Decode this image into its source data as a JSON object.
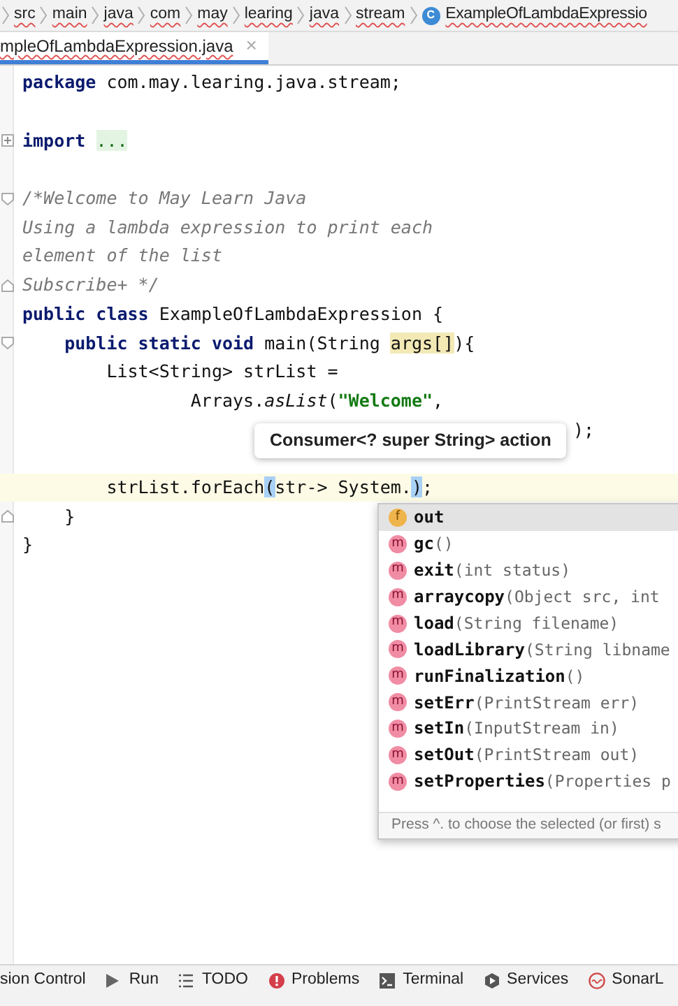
{
  "breadcrumb": {
    "items": [
      "src",
      "main",
      "java",
      "com",
      "may",
      "learing",
      "java",
      "stream"
    ],
    "file": {
      "badge": "C",
      "label": "ExampleOfLambdaExpressio"
    }
  },
  "tabs": [
    {
      "label": "mpleOfLambdaExpression.java",
      "close": "×",
      "selected": true
    }
  ],
  "editor": {
    "lines": [
      {
        "kind": "code",
        "current": false,
        "tokens": [
          {
            "kind": "kw",
            "text": "package"
          },
          {
            "kind": "plain",
            "text": " com.may.learing.java.stream;"
          }
        ]
      },
      {
        "kind": "blank"
      },
      {
        "kind": "code",
        "current": false,
        "fold_marker": {
          "kind": "expand"
        },
        "tokens": [
          {
            "kind": "kw",
            "text": "import "
          },
          {
            "kind": "folded",
            "text": "..."
          }
        ]
      },
      {
        "kind": "blank"
      },
      {
        "kind": "code",
        "current": false,
        "fold_marker": {
          "kind": "start"
        },
        "tokens": [
          {
            "kind": "comment",
            "text": "/*Welcome to May Learn Java"
          }
        ]
      },
      {
        "kind": "code",
        "current": false,
        "tokens": [
          {
            "kind": "comment",
            "text": "Using a lambda expression to print each"
          }
        ]
      },
      {
        "kind": "code",
        "current": false,
        "tokens": [
          {
            "kind": "comment",
            "text": "element of the list"
          }
        ]
      },
      {
        "kind": "code",
        "current": false,
        "fold_marker": {
          "kind": "end"
        },
        "tokens": [
          {
            "kind": "comment",
            "text": "Subscribe+ */"
          }
        ]
      },
      {
        "kind": "code",
        "current": false,
        "tokens": [
          {
            "kind": "kw",
            "text": "public class"
          },
          {
            "kind": "plain",
            "text": " ExampleOfLambdaExpression {"
          }
        ]
      },
      {
        "kind": "code",
        "current": false,
        "fold_marker": {
          "kind": "start"
        },
        "tokens": [
          {
            "kind": "kw",
            "text": "    public static void"
          },
          {
            "kind": "plain",
            "text": " main(String "
          },
          {
            "kind": "usage",
            "text": "args[]"
          },
          {
            "kind": "plain",
            "text": "){"
          }
        ]
      },
      {
        "kind": "code",
        "current": false,
        "tokens": [
          {
            "kind": "plain",
            "text": "        List<String> strList ="
          }
        ]
      },
      {
        "kind": "code",
        "current": false,
        "tokens": [
          {
            "kind": "plain",
            "text": "                Arrays."
          },
          {
            "kind": "static",
            "text": "asList"
          },
          {
            "kind": "plain",
            "text": "("
          },
          {
            "kind": "string",
            "text": "\"Welcome\""
          },
          {
            "kind": "plain",
            "text": ","
          }
        ]
      },
      {
        "kind": "tail",
        "current": false,
        "tokens": [
          {
            "kind": "plain",
            "text": ");"
          }
        ]
      },
      {
        "kind": "blank"
      },
      {
        "kind": "code",
        "current": true,
        "tokens": [
          {
            "kind": "plain",
            "text": "        strList.forEach"
          },
          {
            "kind": "match",
            "text": "("
          },
          {
            "kind": "plain",
            "text": "str-> System."
          },
          {
            "kind": "match",
            "text": ")"
          },
          {
            "kind": "plain",
            "text": ";"
          }
        ]
      },
      {
        "kind": "code",
        "current": false,
        "fold_marker": {
          "kind": "end"
        },
        "tokens": [
          {
            "kind": "plain",
            "text": "    }"
          }
        ]
      },
      {
        "kind": "code",
        "current": false,
        "tokens": [
          {
            "kind": "plain",
            "text": "}"
          }
        ]
      }
    ]
  },
  "tooltip": {
    "text": "Consumer<? super String> action"
  },
  "completion": {
    "items": [
      {
        "kind": "field",
        "badge": "f",
        "name": "out",
        "selected": true
      },
      {
        "kind": "method",
        "badge": "m",
        "name": "gc",
        "params": "()",
        "selected": false
      },
      {
        "kind": "method",
        "badge": "m",
        "name": "exit",
        "params": "(int status)",
        "selected": false
      },
      {
        "kind": "method",
        "badge": "m",
        "name": "arraycopy",
        "params": "(Object src, int",
        "selected": false
      },
      {
        "kind": "method",
        "badge": "m",
        "name": "load",
        "params": "(String filename)",
        "selected": false
      },
      {
        "kind": "method",
        "badge": "m",
        "name": "loadLibrary",
        "params": "(String libname",
        "selected": false
      },
      {
        "kind": "method",
        "badge": "m",
        "name": "runFinalization",
        "params": "()",
        "selected": false
      },
      {
        "kind": "method",
        "badge": "m",
        "name": "setErr",
        "params": "(PrintStream err)",
        "selected": false
      },
      {
        "kind": "method",
        "badge": "m",
        "name": "setIn",
        "params": "(InputStream in)",
        "selected": false
      },
      {
        "kind": "method",
        "badge": "m",
        "name": "setOut",
        "params": "(PrintStream out)",
        "selected": false
      },
      {
        "kind": "method",
        "badge": "m",
        "name": "setProperties",
        "params": "(Properties p",
        "selected": false
      }
    ],
    "hint": "Press ^. to choose the selected (or first) s"
  },
  "tool_windows": [
    {
      "kind": "vcs",
      "label": "sion Control"
    },
    {
      "kind": "run",
      "label": "Run"
    },
    {
      "kind": "todo",
      "label": "TODO"
    },
    {
      "kind": "problems",
      "label": "Problems"
    },
    {
      "kind": "terminal",
      "label": "Terminal"
    },
    {
      "kind": "services",
      "label": "Services"
    },
    {
      "kind": "sonar",
      "label": "SonarL"
    }
  ]
}
